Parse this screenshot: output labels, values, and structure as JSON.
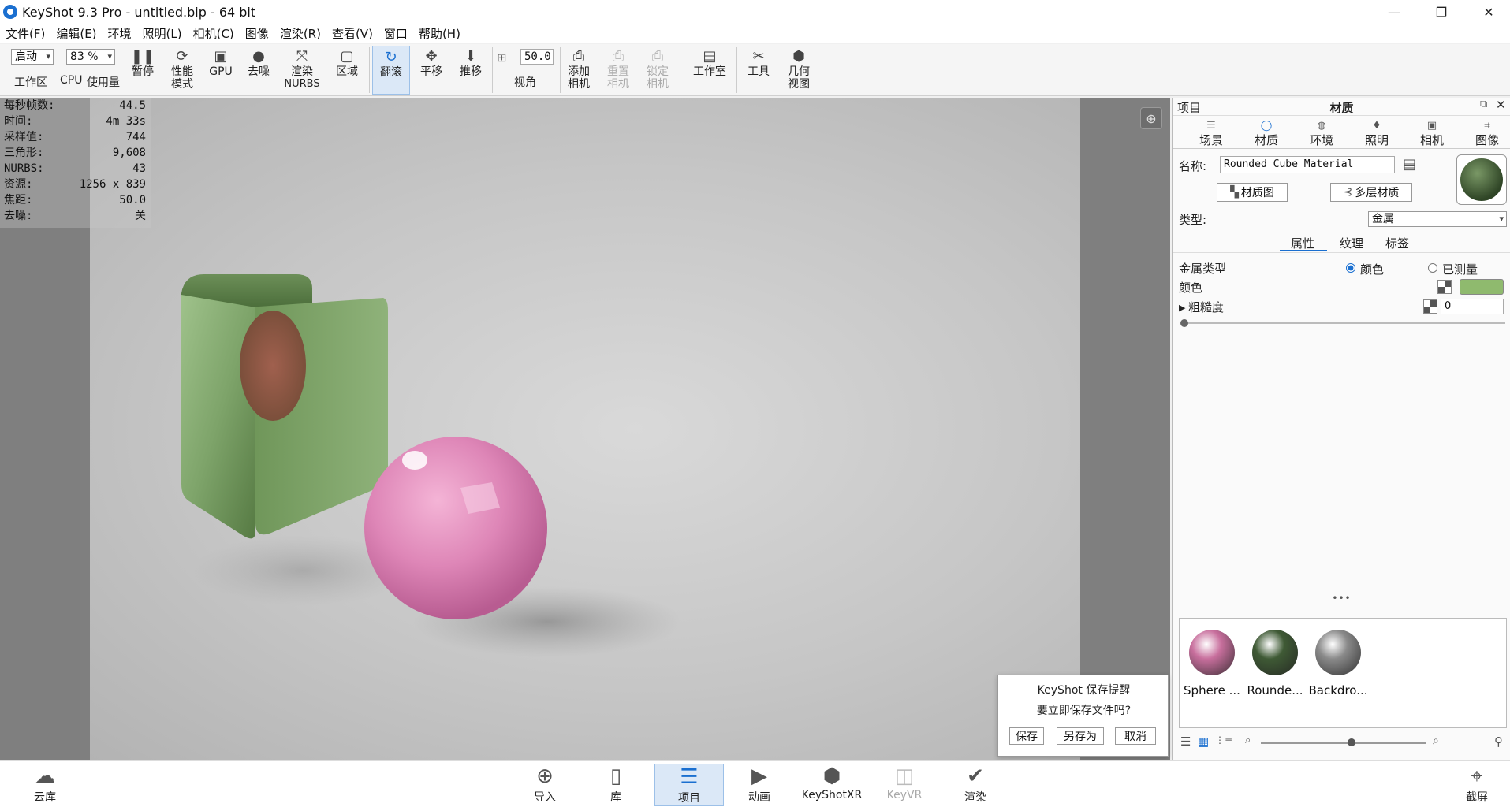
{
  "window": {
    "title": "KeyShot 9.3 Pro  - untitled.bip  - 64 bit",
    "minimize": "—",
    "maximize": "❐",
    "close": "✕"
  },
  "menu": [
    "文件(F)",
    "编辑(E)",
    "环境",
    "照明(L)",
    "相机(C)",
    "图像",
    "渲染(R)",
    "查看(V)",
    "窗口",
    "帮助(H)"
  ],
  "toolbar": {
    "workspace_value": "启动",
    "workspace_label": "工作区",
    "cpu_value": "83 %",
    "cpu_label": "CPU",
    "usage_label": "使用量",
    "pause": "暂停",
    "perf_mode": "性能\n模式",
    "gpu": "GPU",
    "denoise": "去噪",
    "render_nurbs_1": "渲染",
    "render_nurbs_2": "NURBS",
    "region": "区域",
    "tumble": "翻滚",
    "pan": "平移",
    "dolly": "推移",
    "fov_value": "50.0",
    "fov_label": "视角",
    "add_camera_1": "添加",
    "add_camera_2": "相机",
    "reset_camera_1": "重置",
    "reset_camera_2": "相机",
    "lock_camera_1": "锁定",
    "lock_camera_2": "相机",
    "studio": "工作室",
    "tools": "工具",
    "geometry_view_1": "几何",
    "geometry_view_2": "视图"
  },
  "stats": [
    {
      "label": "每秒帧数:",
      "value": "44.5"
    },
    {
      "label": "时间:",
      "value": "4m 33s"
    },
    {
      "label": "采样值:",
      "value": "744"
    },
    {
      "label": "三角形:",
      "value": "9,608"
    },
    {
      "label": "NURBS:",
      "value": "43"
    },
    {
      "label": "资源:",
      "value": "1256 x 839"
    },
    {
      "label": "焦距:",
      "value": "50.0"
    },
    {
      "label": "去噪:",
      "value": "关"
    }
  ],
  "panel": {
    "header_left": "项目",
    "header_title": "材质",
    "tabs": [
      "场景",
      "材质",
      "环境",
      "照明",
      "相机",
      "图像"
    ],
    "name_label": "名称:",
    "name_value": "Rounded Cube Material",
    "material_graph": "材质图",
    "multi_layer": "多层材质",
    "type_label": "类型:",
    "type_value": "金属",
    "subtabs": [
      "属性",
      "纹理",
      "标签"
    ],
    "metal_type_label": "金属类型",
    "radio_color": "颜色",
    "radio_measured": "已测量",
    "color_label": "颜色",
    "color_value": "#8fba6e",
    "roughness_label": "粗糙度",
    "roughness_value": "0",
    "dots": "•••",
    "materials": [
      {
        "name": "Sphere ...",
        "color": "#c86f9d"
      },
      {
        "name": "Rounde...",
        "color": "#3f5a35"
      },
      {
        "name": "Backdro...",
        "color": "#8a8a8a"
      }
    ]
  },
  "dialog": {
    "title": "KeyShot 保存提醒",
    "message": "要立即保存文件吗?",
    "save": "保存",
    "save_as": "另存为",
    "cancel": "取消"
  },
  "statusbar": {
    "cloud": "云库",
    "import": "导入",
    "library": "库",
    "project": "项目",
    "animation": "动画",
    "keyshotxr": "KeyShotXR",
    "keyvr": "KeyVR",
    "render": "渲染",
    "screenshot": "截屏"
  }
}
